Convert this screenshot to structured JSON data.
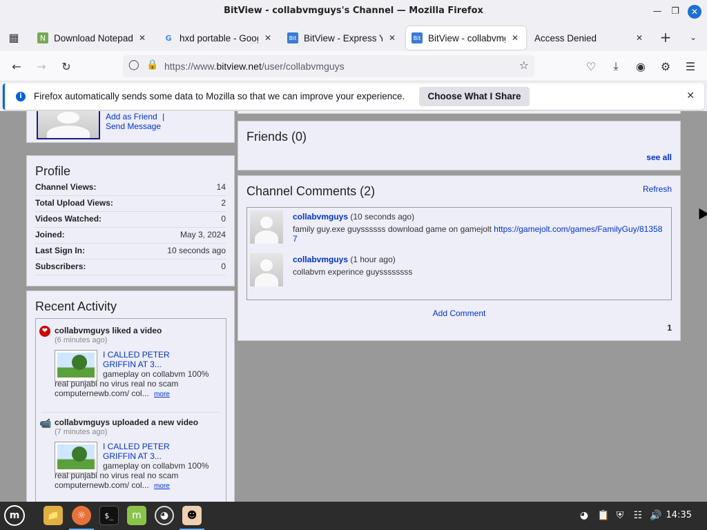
{
  "window": {
    "title": "BitView - collabvmguys's Channel — Mozilla Firefox"
  },
  "tabs": [
    {
      "label": "Download Notepad+",
      "icon": "notepad-icon",
      "active": false
    },
    {
      "label": "hxd portable - Googl",
      "icon": "google-icon",
      "active": false
    },
    {
      "label": "BitView - Express Yo",
      "icon": "bitview-icon",
      "active": false
    },
    {
      "label": "BitView - collabvmgu",
      "icon": "bitview-icon",
      "active": true
    },
    {
      "label": "Access Denied",
      "icon": "",
      "active": false
    }
  ],
  "navbar": {
    "url_prefix": "https://www.",
    "url_domain": "bitview.net",
    "url_path": "/user/collabvmguys"
  },
  "notification": {
    "message": "Firefox automatically sends some data to Mozilla so that we can improve your experience.",
    "button": "Choose What I Share"
  },
  "sidebar": {
    "add_friend": "Add as Friend",
    "separator": "|",
    "send_message": "Send Message",
    "profile": {
      "title": "Profile",
      "rows": [
        {
          "label": "Channel Views:",
          "value": "14"
        },
        {
          "label": "Total Upload Views:",
          "value": "2"
        },
        {
          "label": "Videos Watched:",
          "value": "0"
        },
        {
          "label": "Joined:",
          "value": "May 3, 2024"
        },
        {
          "label": "Last Sign In:",
          "value": "10 seconds ago"
        },
        {
          "label": "Subscribers:",
          "value": "0"
        }
      ]
    },
    "recent_activity": {
      "title": "Recent Activity",
      "items": [
        {
          "headline": "collabvmguys liked a video",
          "time": "(6 minutes ago)",
          "video_title": "I CALLED PETER GRIFFIN AT 3...",
          "description": "gameplay on collabvm 100% real punjabi no virus real no scam computernewb.com/ col...",
          "more": "more",
          "icon": "heart-icon"
        },
        {
          "headline": "collabvmguys uploaded a new video",
          "time": "(7 minutes ago)",
          "video_title": "I CALLED PETER GRIFFIN AT 3...",
          "description": "gameplay on collabvm 100% real punjabi no virus real no scam computernewb.com/ col...",
          "more": "more",
          "icon": "camera-icon"
        }
      ]
    }
  },
  "main": {
    "friends": {
      "title": "Friends (0)",
      "see_all": "see all"
    },
    "comments": {
      "title": "Channel Comments (2)",
      "refresh": "Refresh",
      "items": [
        {
          "author": "collabvmguys",
          "time": "(10 seconds ago)",
          "text": "family guy.exe guyssssss download game on gamejolt ",
          "link": "https://gamejolt.com/games/FamilyGuy/813587"
        },
        {
          "author": "collabvmguys",
          "time": "(1 hour ago)",
          "text": "collabvm experince guyssssssss",
          "link": ""
        }
      ],
      "add_comment": "Add Comment",
      "page": "1"
    }
  },
  "taskbar": {
    "clock": "14:35"
  }
}
